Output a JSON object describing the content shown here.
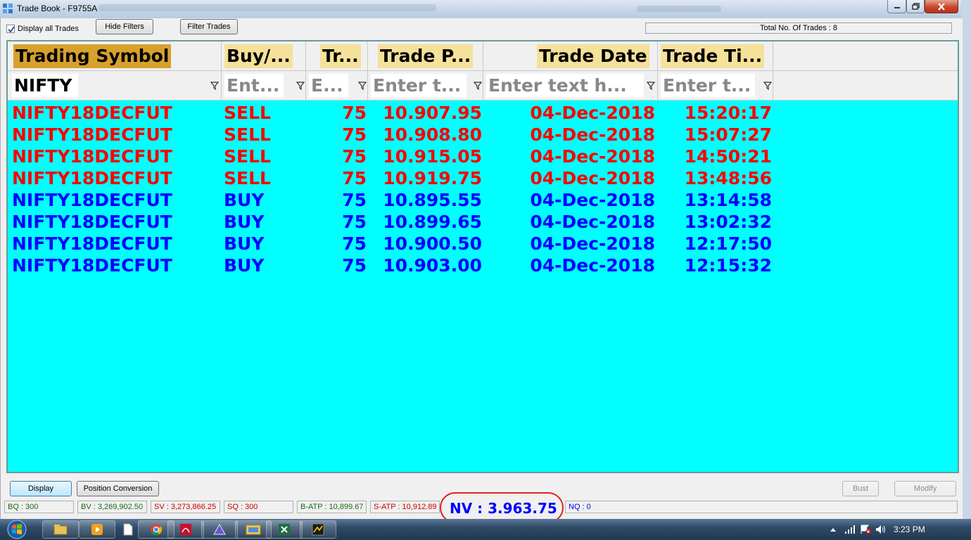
{
  "window": {
    "title": "Trade Book - F9755A"
  },
  "toolbar": {
    "display_all_label": "Display all Trades",
    "display_all_checked": true,
    "hide_filters_label": "Hide Filters",
    "filter_trades_label": "Filter Trades",
    "total_trades_text": "Total No. Of Trades : 8"
  },
  "grid": {
    "columns": [
      "Trading Symbol",
      "Buy/...",
      "Tr...",
      "Trade P...",
      "Trade Date",
      "Trade Ti..."
    ],
    "filters": {
      "symbol": "NIFTY",
      "side": "Ent...",
      "qty": "E...",
      "price": "Enter t...",
      "date": "Enter text h...",
      "time": "Enter t..."
    },
    "rows": [
      {
        "symbol": "NIFTY18DECFUT",
        "side": "SELL",
        "qty": "75",
        "price": "10.907.95",
        "date": "04-Dec-2018",
        "time": "15:20:17"
      },
      {
        "symbol": "NIFTY18DECFUT",
        "side": "SELL",
        "qty": "75",
        "price": "10.908.80",
        "date": "04-Dec-2018",
        "time": "15:07:27"
      },
      {
        "symbol": "NIFTY18DECFUT",
        "side": "SELL",
        "qty": "75",
        "price": "10.915.05",
        "date": "04-Dec-2018",
        "time": "14:50:21"
      },
      {
        "symbol": "NIFTY18DECFUT",
        "side": "SELL",
        "qty": "75",
        "price": "10.919.75",
        "date": "04-Dec-2018",
        "time": "13:48:56"
      },
      {
        "symbol": "NIFTY18DECFUT",
        "side": "BUY",
        "qty": "75",
        "price": "10.895.55",
        "date": "04-Dec-2018",
        "time": "13:14:58"
      },
      {
        "symbol": "NIFTY18DECFUT",
        "side": "BUY",
        "qty": "75",
        "price": "10.899.65",
        "date": "04-Dec-2018",
        "time": "13:02:32"
      },
      {
        "symbol": "NIFTY18DECFUT",
        "side": "BUY",
        "qty": "75",
        "price": "10.900.50",
        "date": "04-Dec-2018",
        "time": "12:17:50"
      },
      {
        "symbol": "NIFTY18DECFUT",
        "side": "BUY",
        "qty": "75",
        "price": "10.903.00",
        "date": "04-Dec-2018",
        "time": "12:15:32"
      }
    ]
  },
  "actions": {
    "display_label": "Display",
    "position_conversion_label": "Position Conversion",
    "bust_label": "Bust",
    "modify_label": "Modify"
  },
  "status": {
    "bq": "BQ : 300",
    "bv": "BV : 3,269,902.50",
    "sv": "SV : 3,273,866.25",
    "sq": "SQ : 300",
    "batp": "B-ATP : 10,899.67",
    "satp": "S-ATP : 10,912.89",
    "nv": "NV : 3.963.75",
    "nq": "NQ : 0"
  },
  "taskbar": {
    "clock": "3:23 PM"
  },
  "colors": {
    "grid_background": "#00ffff",
    "sell": "#ff0000",
    "buy": "#0000ff",
    "header_first": "#d8a12c",
    "header": "#f5e19a",
    "highlight_oval": "#e0201a"
  },
  "icons": {
    "app": "grid-app-icon",
    "filter": "funnel-icon",
    "start": "windows-start-icon"
  }
}
